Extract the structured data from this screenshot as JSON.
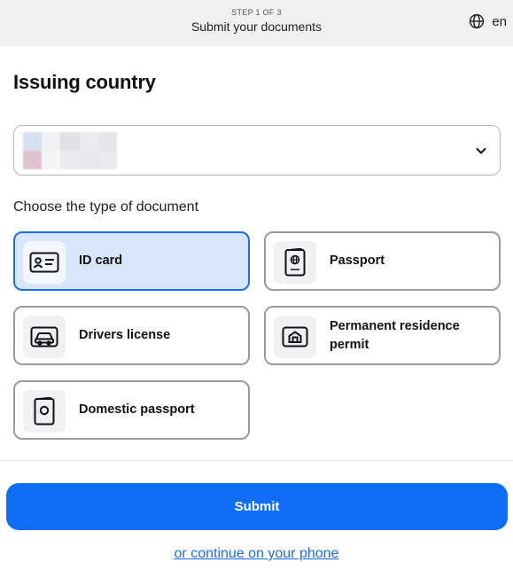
{
  "header": {
    "step": "STEP 1 OF 3",
    "title": "Submit your documents",
    "language": "en",
    "language_icon": "globe-icon"
  },
  "page_title": "Issuing country",
  "country_select": {
    "value_state": "blurred flag/country value",
    "chevron_icon": "chevron-down-icon"
  },
  "document_section": {
    "label": "Choose the type of document",
    "selected": "id_card",
    "options": [
      {
        "id": "id_card",
        "label": "ID card",
        "icon": "id-card-icon"
      },
      {
        "id": "passport",
        "label": "Passport",
        "icon": "passport-icon"
      },
      {
        "id": "drivers_license",
        "label": "Drivers license",
        "icon": "car-icon"
      },
      {
        "id": "residence_permit",
        "label": "Permanent residence permit",
        "icon": "house-icon"
      },
      {
        "id": "domestic_passport",
        "label": "Domestic passport",
        "icon": "domestic-passport-icon"
      }
    ]
  },
  "actions": {
    "submit_label": "Submit",
    "phone_link": "or continue on your phone"
  },
  "colors": {
    "accent": "#0f6ef6",
    "selected_bg": "#d8e5fb",
    "selected_border": "#1a6cf0",
    "card_border": "#9a9aa0",
    "header_bg": "#f1f1f2"
  }
}
